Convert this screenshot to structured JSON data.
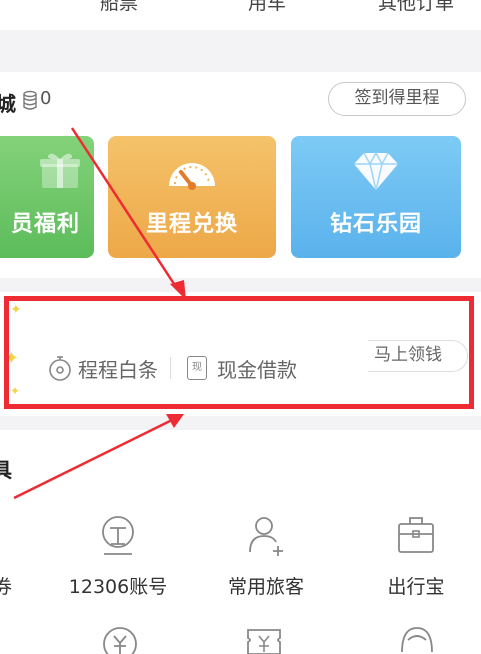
{
  "top_tabs": [
    "船票",
    "用车",
    "其他订单"
  ],
  "mileage": {
    "title_fragment": "城",
    "coin_count": "0",
    "sign_button": "签到得里程",
    "cards": [
      {
        "label": "员福利",
        "color": "#6cc464"
      },
      {
        "label": "里程兑换",
        "color": "#f0b556"
      },
      {
        "label": "钻石乐园",
        "color": "#68bcf0"
      }
    ]
  },
  "loan": {
    "items": [
      "程程白条",
      "现金借款"
    ],
    "cash_icon_char": "现",
    "action_button": "马上领钱"
  },
  "tools": {
    "title_fragment": "具",
    "items": [
      {
        "label": "券"
      },
      {
        "label": "12306账号"
      },
      {
        "label": "常用旅客"
      },
      {
        "label": "出行宝"
      }
    ]
  },
  "colors": {
    "annotation_red": "#ee2b33",
    "background_gray": "#f3f3f5"
  }
}
